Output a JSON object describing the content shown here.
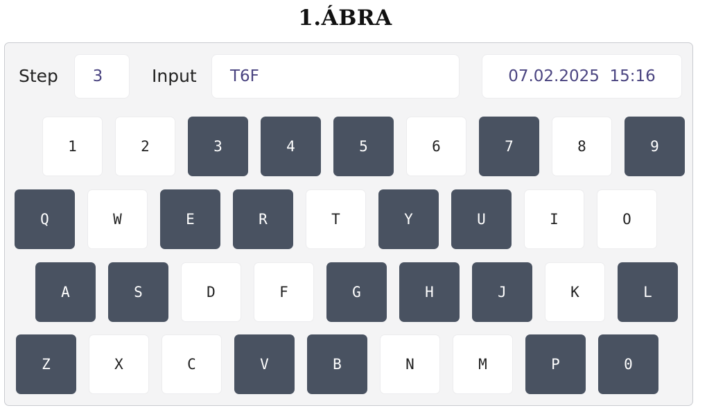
{
  "title": "1.ÁBRA",
  "header": {
    "step_label": "Step",
    "step_value": "3",
    "input_label": "Input",
    "input_value": "T6F",
    "datetime": "07.02.2025  15:16"
  },
  "colors": {
    "panel_background": "#f4f4f5",
    "key_light": "#ffffff",
    "key_dark": "#495261",
    "field_text": "#4a4480"
  },
  "keyboard": {
    "rows": [
      [
        {
          "label": "1",
          "highlighted": false
        },
        {
          "label": "2",
          "highlighted": false
        },
        {
          "label": "3",
          "highlighted": true
        },
        {
          "label": "4",
          "highlighted": true
        },
        {
          "label": "5",
          "highlighted": true
        },
        {
          "label": "6",
          "highlighted": false
        },
        {
          "label": "7",
          "highlighted": true
        },
        {
          "label": "8",
          "highlighted": false
        },
        {
          "label": "9",
          "highlighted": true
        }
      ],
      [
        {
          "label": "Q",
          "highlighted": true
        },
        {
          "label": "W",
          "highlighted": false
        },
        {
          "label": "E",
          "highlighted": true
        },
        {
          "label": "R",
          "highlighted": true
        },
        {
          "label": "T",
          "highlighted": false
        },
        {
          "label": "Y",
          "highlighted": true
        },
        {
          "label": "U",
          "highlighted": true
        },
        {
          "label": "I",
          "highlighted": false
        },
        {
          "label": "O",
          "highlighted": false
        }
      ],
      [
        {
          "label": "A",
          "highlighted": true
        },
        {
          "label": "S",
          "highlighted": true
        },
        {
          "label": "D",
          "highlighted": false
        },
        {
          "label": "F",
          "highlighted": false
        },
        {
          "label": "G",
          "highlighted": true
        },
        {
          "label": "H",
          "highlighted": true
        },
        {
          "label": "J",
          "highlighted": true
        },
        {
          "label": "K",
          "highlighted": false
        },
        {
          "label": "L",
          "highlighted": true
        }
      ],
      [
        {
          "label": "Z",
          "highlighted": true
        },
        {
          "label": "X",
          "highlighted": false
        },
        {
          "label": "C",
          "highlighted": false
        },
        {
          "label": "V",
          "highlighted": true
        },
        {
          "label": "B",
          "highlighted": true
        },
        {
          "label": "N",
          "highlighted": false
        },
        {
          "label": "M",
          "highlighted": false
        },
        {
          "label": "P",
          "highlighted": true
        },
        {
          "label": "0",
          "highlighted": true
        }
      ]
    ]
  }
}
